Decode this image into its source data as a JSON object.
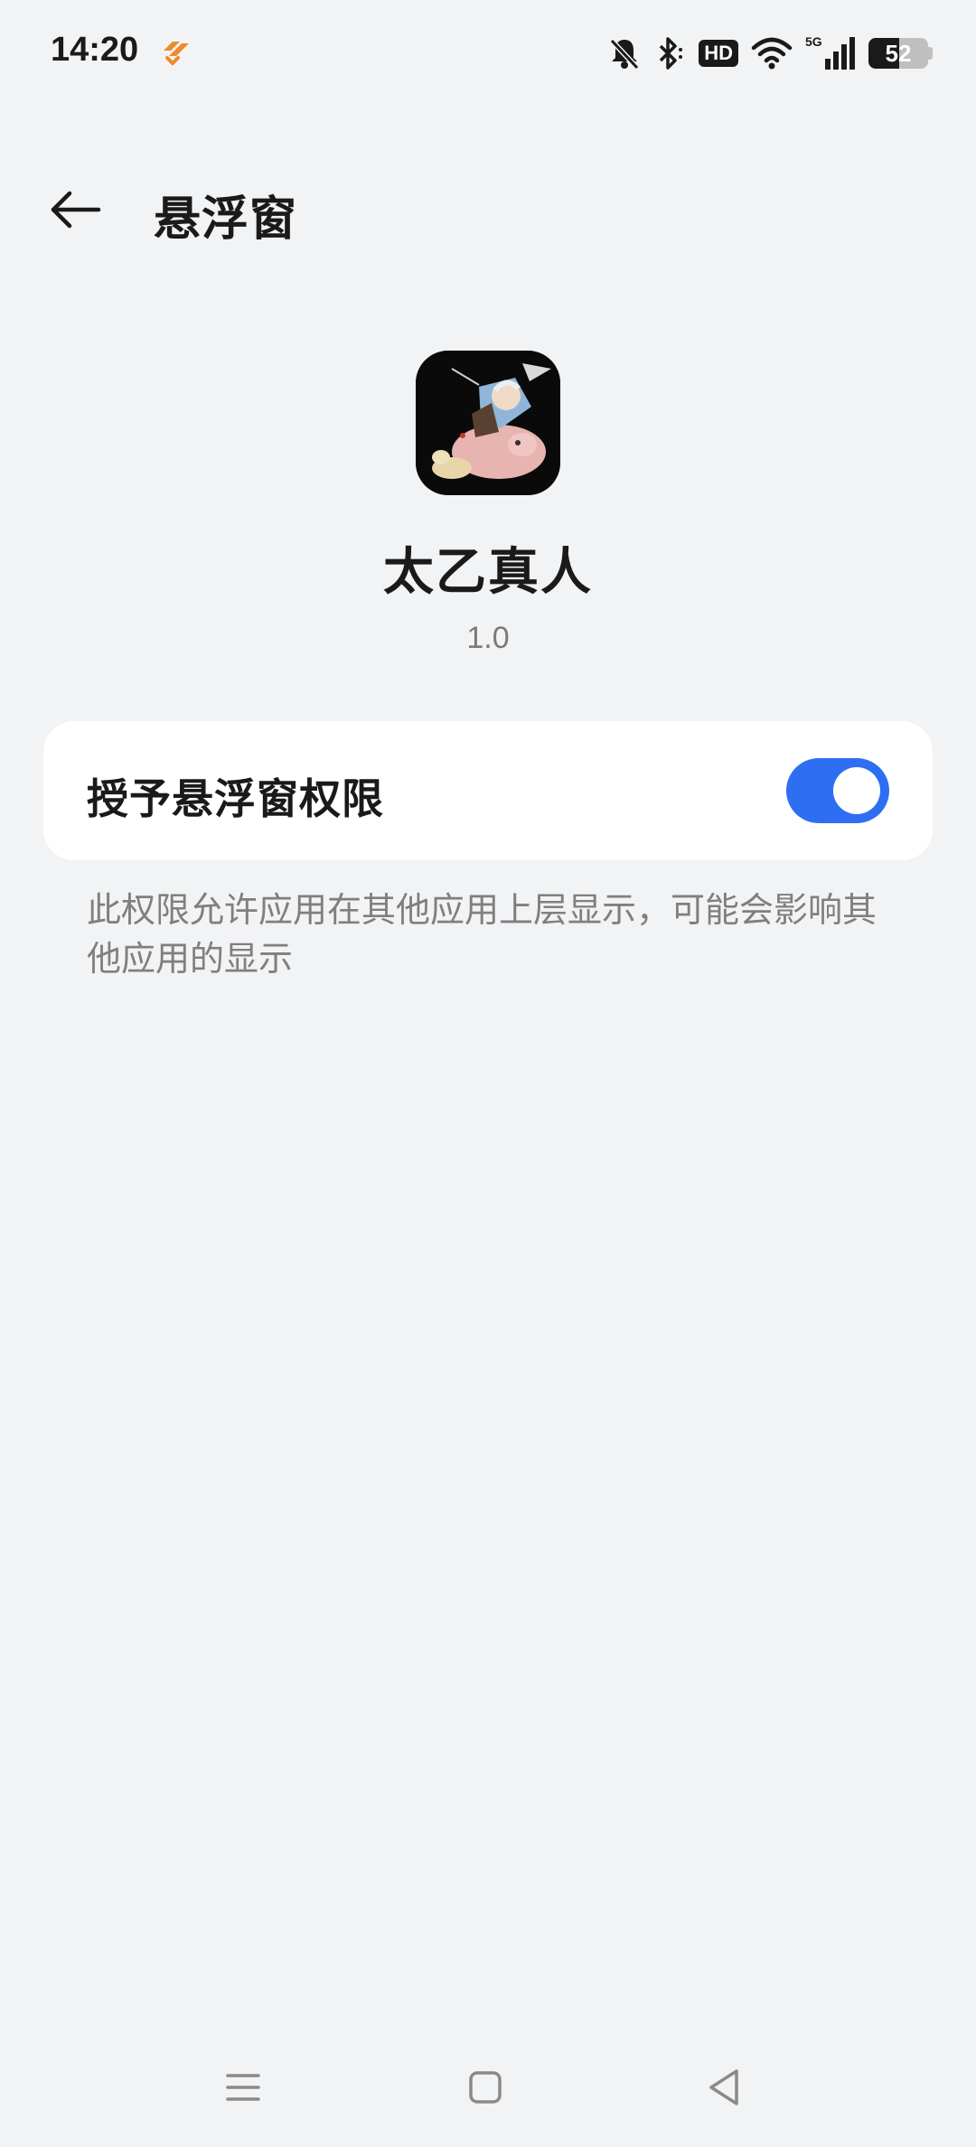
{
  "status_bar": {
    "time": "14:20",
    "hd_label": "HD",
    "network_label": "5G",
    "battery_level": "52",
    "battery_fraction": 0.52,
    "icons": [
      "mute-bell-icon",
      "bluetooth-icon",
      "hd-icon",
      "wifi-icon",
      "signal-icon",
      "battery-icon"
    ]
  },
  "header": {
    "title": "悬浮窗",
    "back_icon": "back-arrow-icon"
  },
  "app": {
    "name": "太乙真人",
    "version": "1.0"
  },
  "permission": {
    "label": "授予悬浮窗权限",
    "enabled": true,
    "toggle_color": "#2e6ef2",
    "description": "此权限允许应用在其他应用上层显示，可能会影响其他应用的显示"
  },
  "nav_bar": {
    "icons": [
      "menu-icon",
      "home-icon",
      "back-icon"
    ]
  }
}
